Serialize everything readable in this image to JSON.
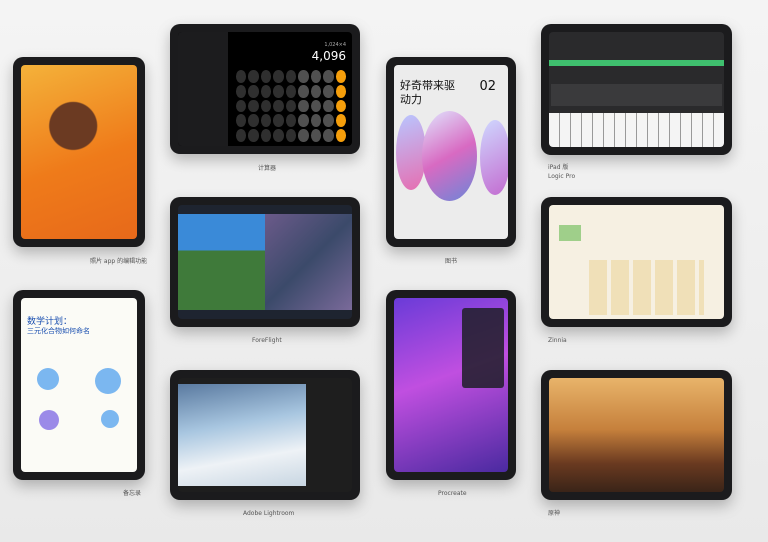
{
  "captions": {
    "photos": "照片 app 的编辑功能",
    "calculator": "计算器",
    "books": "图书",
    "logic_line1": "iPad 版",
    "logic_line2": "Logic Pro",
    "foreflight": "ForeFlight",
    "zinnia": "Zinnia",
    "notes": "备忘录",
    "procreate": "Procreate",
    "lightroom": "Adobe Lightroom",
    "game": "原神"
  },
  "calculator": {
    "display": "4,096",
    "sub": "1,024×4"
  },
  "books": {
    "title": "好奇带来驱动力",
    "number": "02"
  },
  "notes": {
    "title": "数学计划：",
    "subtitle": "三元化合物如何命名"
  },
  "colors": {
    "background": "#eeeeee",
    "bezel": "#1b1b1d",
    "calc_orange": "#f59e0b"
  }
}
